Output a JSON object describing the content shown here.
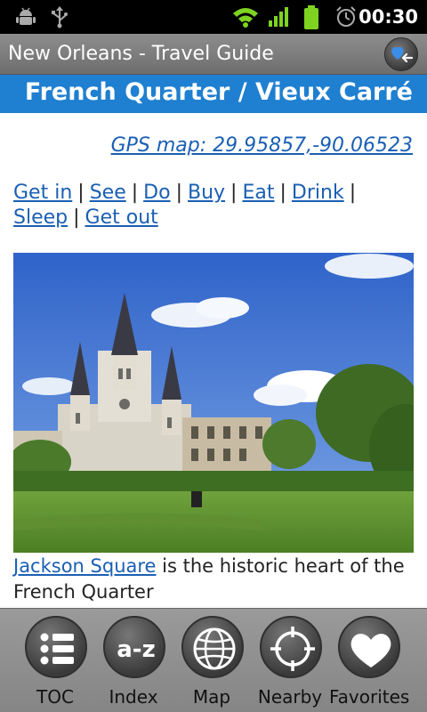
{
  "status_bar": {
    "time": "00:30"
  },
  "header": {
    "app_title": "New Orleans - Travel Guide"
  },
  "banner": {
    "title": "French Quarter / Vieux Carré"
  },
  "content": {
    "gps_link": "GPS map: 29.95857,-90.06523",
    "section_links": [
      "Get in",
      "See",
      "Do",
      "Buy",
      "Eat",
      "Drink",
      "Sleep",
      "Get out"
    ],
    "caption_link": "Jackson Square",
    "caption_text": " is the historic heart of the French Quarter"
  },
  "toolbar": {
    "items": [
      {
        "label": "TOC",
        "icon": "list-icon"
      },
      {
        "label": "Index",
        "icon": "a-z-icon"
      },
      {
        "label": "Map",
        "icon": "globe-icon"
      },
      {
        "label": "Nearby",
        "icon": "crosshair-icon"
      },
      {
        "label": "Favorites",
        "icon": "heart-icon"
      }
    ],
    "index_glyph": "a-z"
  },
  "colors": {
    "accent": "#1f7fd0",
    "link": "#1a5fb4"
  }
}
